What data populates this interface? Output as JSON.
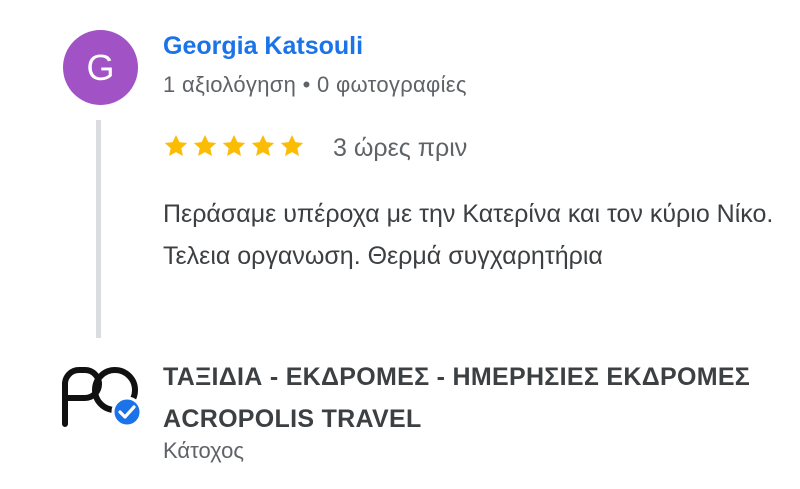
{
  "reviewer": {
    "avatar_letter": "G",
    "avatar_color": "#a152c4",
    "name": "Georgia Katsouli",
    "meta": "1 αξιολόγηση • 0 φωτογραφίες"
  },
  "review": {
    "rating": 5,
    "rating_max": 5,
    "star_color": "#fbbc04",
    "time": "3 ώρες πριν",
    "text": "Περάσαμε υπέροχα με την Κατερίνα και τον κύριο Νίκο. Τελεια οργανωση. Θερμά συγχαρητήρια"
  },
  "owner_reply": {
    "logo_text": "PO",
    "verified_badge_color": "#1a73e8",
    "name": "ΤΑΞΙΔΙΑ - ΕΚΔΡΟΜΕΣ - ΗΜΕΡΗΣΙΕΣ ΕΚΔΡΟΜΕΣ ACROPOLIS TRAVEL",
    "role": "Κάτοχος"
  },
  "colors": {
    "link_blue": "#1a73e8",
    "text_primary": "#3c4043",
    "text_secondary": "#5f6368",
    "thread_line": "#dadce0"
  }
}
